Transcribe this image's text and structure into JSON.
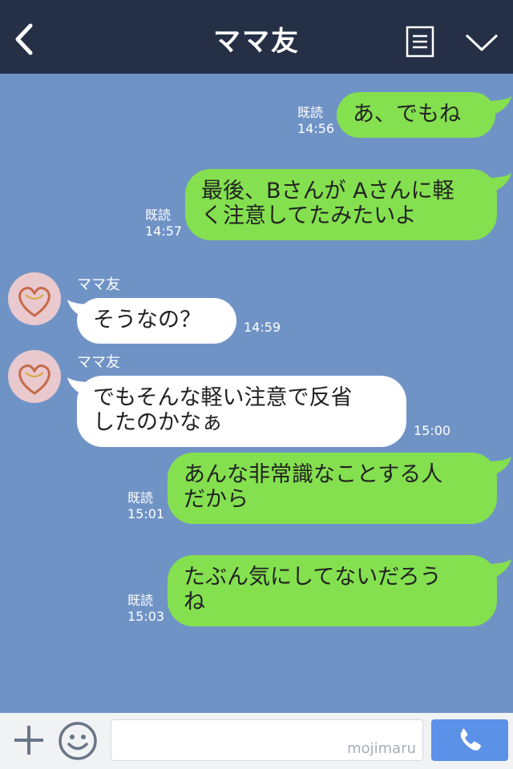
{
  "header": {
    "title": "ママ友"
  },
  "messages": [
    {
      "side": "out",
      "lines": [
        "あ、でもね"
      ],
      "read": "既読",
      "time": "14:56"
    },
    {
      "side": "out",
      "lines": [
        "最後、Bさんが Aさんに軽",
        "く注意してたみたいよ"
      ],
      "read": "既読",
      "time": "14:57"
    },
    {
      "side": "in",
      "sender": "ママ友",
      "lines": [
        "そうなの？"
      ],
      "time": "14:59"
    },
    {
      "side": "in",
      "sender": "ママ友",
      "lines": [
        "でもそんな軽い注意で反省",
        "したのかなぁ"
      ],
      "time": "15:00"
    },
    {
      "side": "out",
      "lines": [
        "あんな非常識なことする人",
        "だから"
      ],
      "read": "既読",
      "time": "15:01"
    },
    {
      "side": "out",
      "lines": [
        "たぶん気にしてないだろう",
        "ね"
      ],
      "read": "既読",
      "time": "15:03"
    }
  ],
  "footer": {
    "input_value": "",
    "watermark": "mojimaru"
  },
  "colors": {
    "background": "#7093c6",
    "header": "#253046",
    "sent_bubble": "#84e04f",
    "received_bubble": "#ffffff",
    "call_button": "#5b91e6"
  },
  "icons": {
    "back": "chevron-left-icon",
    "menu": "menu-icon",
    "collapse": "chevron-down-icon",
    "plus": "plus-icon",
    "emoji": "smiley-icon",
    "call": "phone-icon"
  }
}
